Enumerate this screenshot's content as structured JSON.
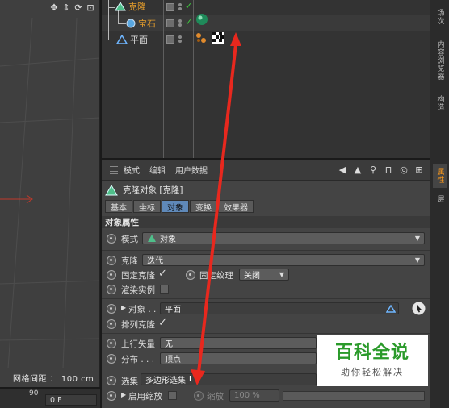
{
  "viewport": {
    "grid_spacing_label": "网格间距 ： 100 cm",
    "toolbar_icons": [
      "move-icon",
      "rotate-icon",
      "zoom-icon",
      "maximize-icon"
    ]
  },
  "object_manager": {
    "objects": [
      {
        "name": "克隆",
        "color": "#e09a2c",
        "icon": "cloner-icon"
      },
      {
        "name": "宝石",
        "color": "#e09a2c",
        "icon": "gem-icon"
      },
      {
        "name": "平面",
        "color": "#d9d9d9",
        "icon": "plane-icon"
      }
    ]
  },
  "right_tabs": [
    "场次",
    "内容浏览器",
    "构造",
    "属性",
    "层"
  ],
  "attribute_manager": {
    "menu": [
      "模式",
      "编辑",
      "用户数据"
    ],
    "object_title": "克隆对象 [克隆]",
    "tabs": [
      "基本",
      "坐标",
      "对象",
      "变换",
      "效果器"
    ],
    "active_tab": "对象",
    "section_title": "对象属性",
    "properties": {
      "mode_label": "模式",
      "mode_value": "对象",
      "clone_label": "克隆",
      "clone_value": "迭代",
      "fix_clone_label": "固定克隆",
      "fix_clone_checked": "✓",
      "fix_texture_label": "固定纹理",
      "fix_texture_value": "关闭",
      "render_instances_label": "渲染实例",
      "object_label": "对象 . .",
      "object_value": "平面",
      "arrange_clone_label": "排列克隆",
      "arrange_clone_checked": "✓",
      "up_vector_label": "上行矢量",
      "up_vector_value": "无",
      "distribution_label": "分布 . . .",
      "distribution_value": "顶点",
      "selection_label": "选集",
      "selection_value": "多边形选集",
      "enable_scale_label": "启用缩放",
      "scale_label": "缩放",
      "scale_value": "100 %"
    }
  },
  "bottom": {
    "frame_number": "90",
    "frame_field": "0 F"
  },
  "watermark": {
    "title": "百科全说",
    "subtitle": "助你轻松解决"
  },
  "colors": {
    "accent_orange": "#e09a2c",
    "active_tab_blue": "#5f89b9",
    "arrow_red": "#e8281e"
  }
}
